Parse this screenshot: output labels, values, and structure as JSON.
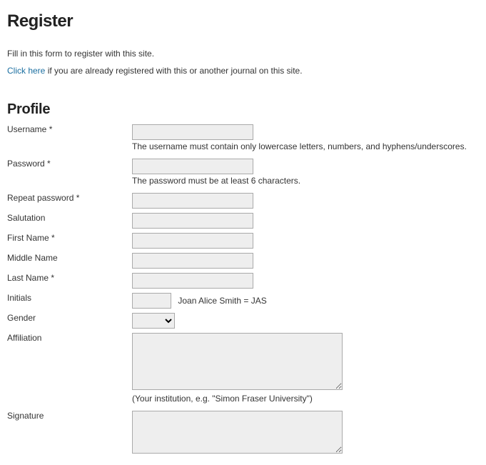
{
  "page": {
    "title": "Register",
    "intro": "Fill in this form to register with this site.",
    "login_link_text": "Click here",
    "login_rest": " if you are already registered with this or another journal on this site."
  },
  "profile": {
    "heading": "Profile",
    "username_label": "Username *",
    "username_hint": "The username must contain only lowercase letters, numbers, and hyphens/underscores.",
    "password_label": "Password *",
    "password_hint": "The password must be at least 6 characters.",
    "repeat_password_label": "Repeat password *",
    "salutation_label": "Salutation",
    "first_name_label": "First Name *",
    "middle_name_label": "Middle Name",
    "last_name_label": "Last Name *",
    "initials_label": "Initials",
    "initials_hint": "Joan Alice Smith = JAS",
    "gender_label": "Gender",
    "gender_options": [
      ""
    ],
    "affiliation_label": "Affiliation",
    "affiliation_hint": "(Your institution, e.g. \"Simon Fraser University\")",
    "signature_label": "Signature"
  }
}
